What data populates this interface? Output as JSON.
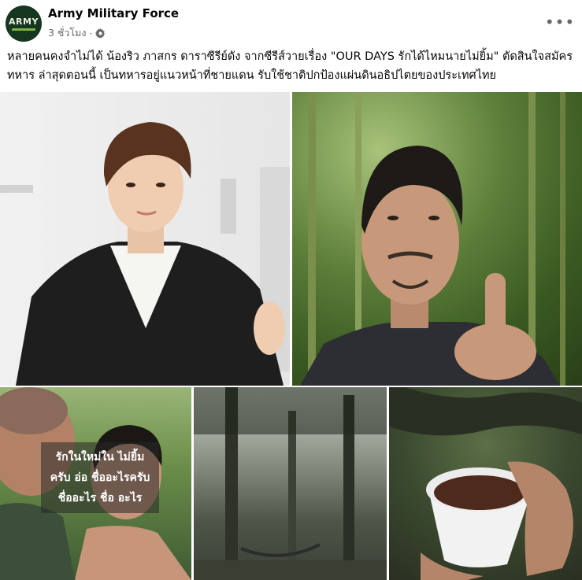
{
  "post": {
    "page_name": "Army Military Force",
    "timestamp": "3 ชั่วโมง",
    "separator": "·",
    "privacy_icon": "gear-icon",
    "more_icon": "more-horizontal-icon",
    "more_label": "•••",
    "avatar_text": "ARMY",
    "caption": "หลายคนคงจำไม่ได้ น้องริว ภาสกร ดาราซีรีย์ดัง จากซีรีส์วายเรื่อง \"OUR DAYS รักได้ไหมนายไม่ยิ้ม\" ตัดสินใจสมัครทหาร ล่าสุดตอนนี้ เป็นทหารอยู่แนวหน้าที่ชายแดน รับใช้ชาติปกป้องแผ่นดินอธิปไตยของประเทศไทย"
  },
  "photos": {
    "overlay_text": "รักในใหม่ใน ไม่ยิ้มครับ อ่อ ชื่ออะไรครับ ชื่ออะไร ชื่อ อะไร"
  },
  "colors": {
    "text_primary": "#050505",
    "text_secondary": "#65676b",
    "avatar_bg": "#16361f"
  }
}
